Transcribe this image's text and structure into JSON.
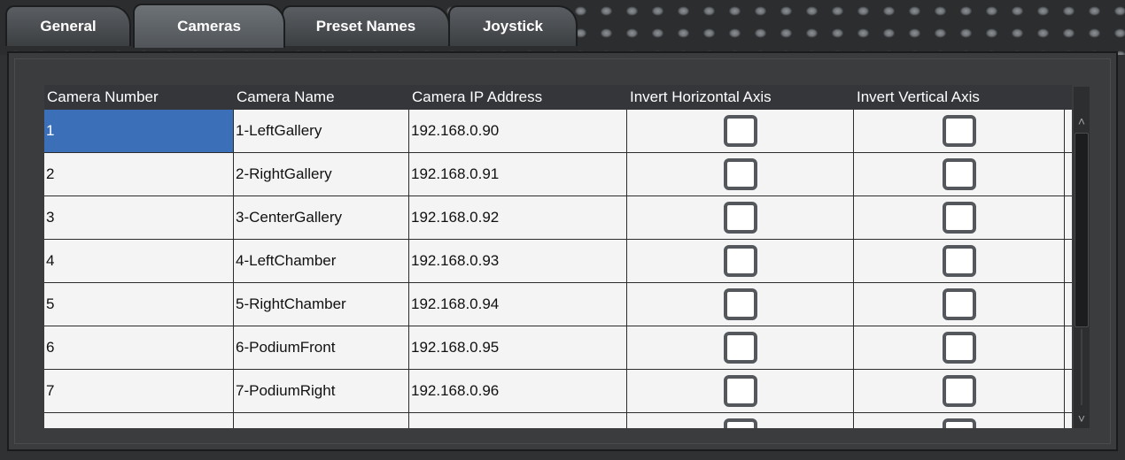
{
  "tabs": [
    {
      "label": "General",
      "active": false
    },
    {
      "label": "Cameras",
      "active": true
    },
    {
      "label": "Preset Names",
      "active": false
    },
    {
      "label": "Joystick",
      "active": false
    }
  ],
  "table": {
    "headers": [
      "Camera Number",
      "Camera Name",
      "Camera IP Address",
      "Invert Horizontal Axis",
      "Invert Vertical Axis"
    ],
    "rows": [
      {
        "number": "1",
        "name": "1-LeftGallery",
        "ip": "192.168.0.90",
        "invert_h": false,
        "invert_v": false,
        "selected": true
      },
      {
        "number": "2",
        "name": "2-RightGallery",
        "ip": "192.168.0.91",
        "invert_h": false,
        "invert_v": false,
        "selected": false
      },
      {
        "number": "3",
        "name": "3-CenterGallery",
        "ip": "192.168.0.92",
        "invert_h": false,
        "invert_v": false,
        "selected": false
      },
      {
        "number": "4",
        "name": "4-LeftChamber",
        "ip": "192.168.0.93",
        "invert_h": false,
        "invert_v": false,
        "selected": false
      },
      {
        "number": "5",
        "name": "5-RightChamber",
        "ip": "192.168.0.94",
        "invert_h": false,
        "invert_v": false,
        "selected": false
      },
      {
        "number": "6",
        "name": "6-PodiumFront",
        "ip": "192.168.0.95",
        "invert_h": false,
        "invert_v": false,
        "selected": false
      },
      {
        "number": "7",
        "name": "7-PodiumRight",
        "ip": "192.168.0.96",
        "invert_h": false,
        "invert_v": false,
        "selected": false
      },
      {
        "number": "",
        "name": "",
        "ip": "",
        "invert_h": false,
        "invert_v": false,
        "selected": false
      }
    ]
  },
  "icons": {
    "column_chooser": "column-chooser-icon",
    "scroll_up": "chevron-up-icon",
    "scroll_down": "chevron-down-icon"
  },
  "colors": {
    "selection": "#3b6fb8",
    "background": "#3a3c3e",
    "header": "#34363a"
  }
}
